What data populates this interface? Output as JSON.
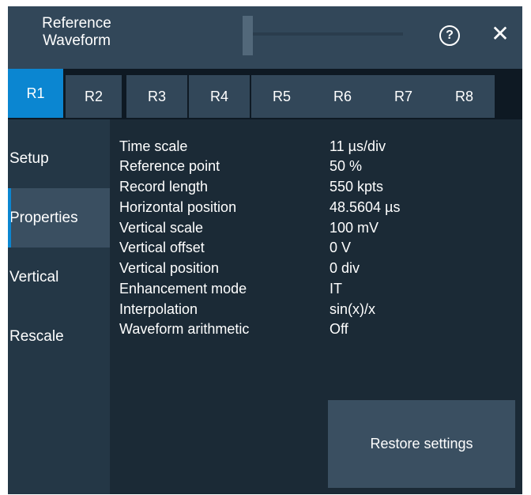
{
  "header": {
    "title_line1": "Reference",
    "title_line2": "Waveform",
    "help_icon": "?",
    "close_icon": "✕"
  },
  "tabs": [
    {
      "label": "R1",
      "active": true
    },
    {
      "label": "R2"
    },
    {
      "label": "R3"
    },
    {
      "label": "R4"
    },
    {
      "label": "R5"
    },
    {
      "label": "R6"
    },
    {
      "label": "R7"
    },
    {
      "label": "R8"
    }
  ],
  "sidebar": {
    "items": [
      {
        "label": "Setup"
      },
      {
        "label": "Properties",
        "active": true
      },
      {
        "label": "Vertical"
      },
      {
        "label": "Rescale"
      }
    ]
  },
  "properties": [
    {
      "label": "Time scale",
      "value": "11 µs/div"
    },
    {
      "label": "Reference point",
      "value": "50 %"
    },
    {
      "label": "Record length",
      "value": "550 kpts"
    },
    {
      "label": "Horizontal position",
      "value": "48.5604 µs"
    },
    {
      "label": "Vertical scale",
      "value": "100 mV"
    },
    {
      "label": "Vertical offset",
      "value": "0 V"
    },
    {
      "label": "Vertical position",
      "value": "0 div"
    },
    {
      "label": "Enhancement mode",
      "value": "IT"
    },
    {
      "label": "Interpolation",
      "value": "sin(x)/x"
    },
    {
      "label": "Waveform arithmetic",
      "value": "Off"
    }
  ],
  "actions": {
    "restore_label": "Restore settings"
  },
  "colors": {
    "accent": "#0b86d1",
    "title_bar": "#324759",
    "panel": "#1b2a36"
  }
}
